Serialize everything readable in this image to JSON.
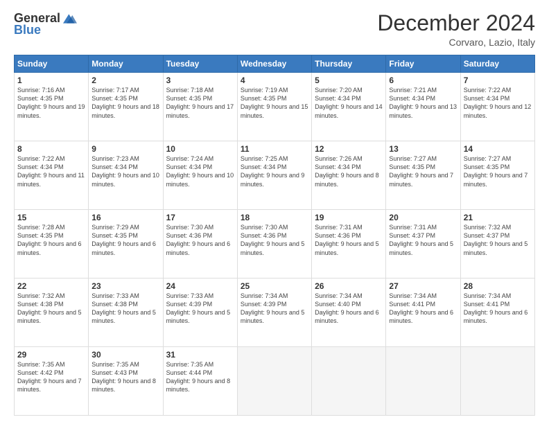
{
  "header": {
    "logo_general": "General",
    "logo_blue": "Blue",
    "month": "December 2024",
    "location": "Corvaro, Lazio, Italy"
  },
  "days_of_week": [
    "Sunday",
    "Monday",
    "Tuesday",
    "Wednesday",
    "Thursday",
    "Friday",
    "Saturday"
  ],
  "weeks": [
    [
      {
        "day": "1",
        "sunrise": "7:16 AM",
        "sunset": "4:35 PM",
        "daylight": "9 hours and 19 minutes."
      },
      {
        "day": "2",
        "sunrise": "7:17 AM",
        "sunset": "4:35 PM",
        "daylight": "9 hours and 18 minutes."
      },
      {
        "day": "3",
        "sunrise": "7:18 AM",
        "sunset": "4:35 PM",
        "daylight": "9 hours and 17 minutes."
      },
      {
        "day": "4",
        "sunrise": "7:19 AM",
        "sunset": "4:35 PM",
        "daylight": "9 hours and 15 minutes."
      },
      {
        "day": "5",
        "sunrise": "7:20 AM",
        "sunset": "4:34 PM",
        "daylight": "9 hours and 14 minutes."
      },
      {
        "day": "6",
        "sunrise": "7:21 AM",
        "sunset": "4:34 PM",
        "daylight": "9 hours and 13 minutes."
      },
      {
        "day": "7",
        "sunrise": "7:22 AM",
        "sunset": "4:34 PM",
        "daylight": "9 hours and 12 minutes."
      }
    ],
    [
      {
        "day": "8",
        "sunrise": "7:22 AM",
        "sunset": "4:34 PM",
        "daylight": "9 hours and 11 minutes."
      },
      {
        "day": "9",
        "sunrise": "7:23 AM",
        "sunset": "4:34 PM",
        "daylight": "9 hours and 10 minutes."
      },
      {
        "day": "10",
        "sunrise": "7:24 AM",
        "sunset": "4:34 PM",
        "daylight": "9 hours and 10 minutes."
      },
      {
        "day": "11",
        "sunrise": "7:25 AM",
        "sunset": "4:34 PM",
        "daylight": "9 hours and 9 minutes."
      },
      {
        "day": "12",
        "sunrise": "7:26 AM",
        "sunset": "4:34 PM",
        "daylight": "9 hours and 8 minutes."
      },
      {
        "day": "13",
        "sunrise": "7:27 AM",
        "sunset": "4:35 PM",
        "daylight": "9 hours and 7 minutes."
      },
      {
        "day": "14",
        "sunrise": "7:27 AM",
        "sunset": "4:35 PM",
        "daylight": "9 hours and 7 minutes."
      }
    ],
    [
      {
        "day": "15",
        "sunrise": "7:28 AM",
        "sunset": "4:35 PM",
        "daylight": "9 hours and 6 minutes."
      },
      {
        "day": "16",
        "sunrise": "7:29 AM",
        "sunset": "4:35 PM",
        "daylight": "9 hours and 6 minutes."
      },
      {
        "day": "17",
        "sunrise": "7:30 AM",
        "sunset": "4:36 PM",
        "daylight": "9 hours and 6 minutes."
      },
      {
        "day": "18",
        "sunrise": "7:30 AM",
        "sunset": "4:36 PM",
        "daylight": "9 hours and 5 minutes."
      },
      {
        "day": "19",
        "sunrise": "7:31 AM",
        "sunset": "4:36 PM",
        "daylight": "9 hours and 5 minutes."
      },
      {
        "day": "20",
        "sunrise": "7:31 AM",
        "sunset": "4:37 PM",
        "daylight": "9 hours and 5 minutes."
      },
      {
        "day": "21",
        "sunrise": "7:32 AM",
        "sunset": "4:37 PM",
        "daylight": "9 hours and 5 minutes."
      }
    ],
    [
      {
        "day": "22",
        "sunrise": "7:32 AM",
        "sunset": "4:38 PM",
        "daylight": "9 hours and 5 minutes."
      },
      {
        "day": "23",
        "sunrise": "7:33 AM",
        "sunset": "4:38 PM",
        "daylight": "9 hours and 5 minutes."
      },
      {
        "day": "24",
        "sunrise": "7:33 AM",
        "sunset": "4:39 PM",
        "daylight": "9 hours and 5 minutes."
      },
      {
        "day": "25",
        "sunrise": "7:34 AM",
        "sunset": "4:39 PM",
        "daylight": "9 hours and 5 minutes."
      },
      {
        "day": "26",
        "sunrise": "7:34 AM",
        "sunset": "4:40 PM",
        "daylight": "9 hours and 6 minutes."
      },
      {
        "day": "27",
        "sunrise": "7:34 AM",
        "sunset": "4:41 PM",
        "daylight": "9 hours and 6 minutes."
      },
      {
        "day": "28",
        "sunrise": "7:34 AM",
        "sunset": "4:41 PM",
        "daylight": "9 hours and 6 minutes."
      }
    ],
    [
      {
        "day": "29",
        "sunrise": "7:35 AM",
        "sunset": "4:42 PM",
        "daylight": "9 hours and 7 minutes."
      },
      {
        "day": "30",
        "sunrise": "7:35 AM",
        "sunset": "4:43 PM",
        "daylight": "9 hours and 8 minutes."
      },
      {
        "day": "31",
        "sunrise": "7:35 AM",
        "sunset": "4:44 PM",
        "daylight": "9 hours and 8 minutes."
      },
      null,
      null,
      null,
      null
    ]
  ]
}
